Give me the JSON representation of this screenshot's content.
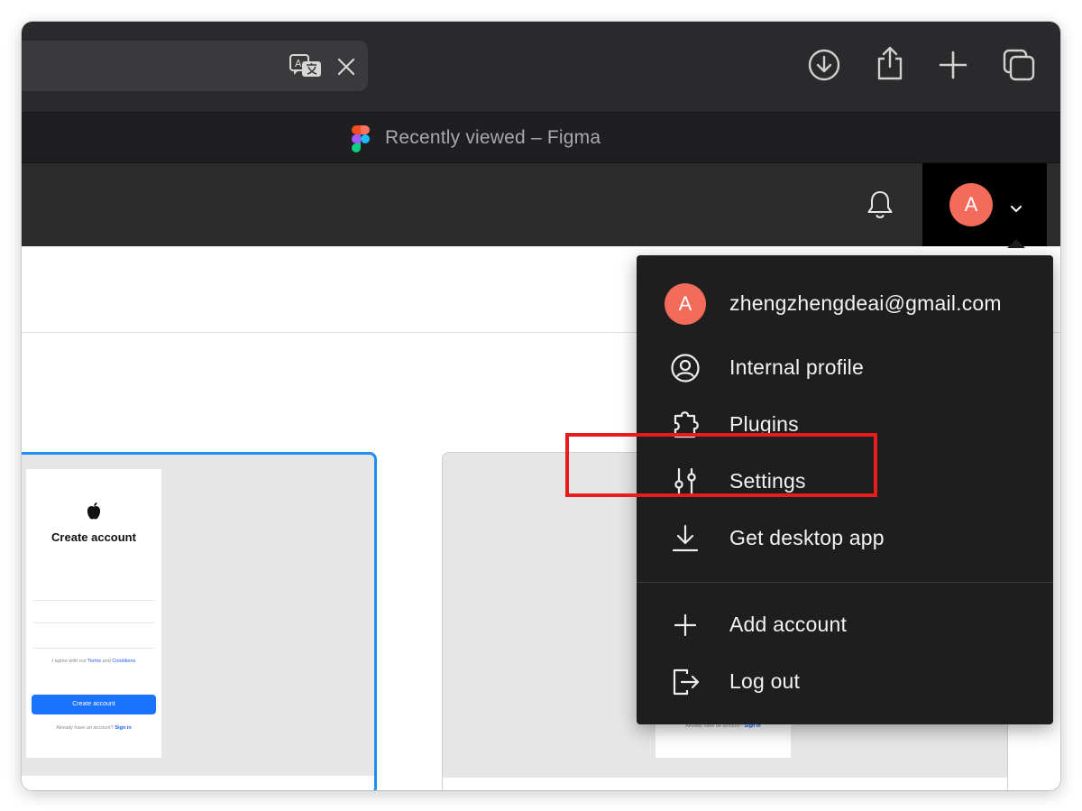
{
  "tab": {
    "title": "Recently viewed – Figma"
  },
  "account": {
    "avatar_initial": "A",
    "email": "zhengzhengdeai@gmail.com"
  },
  "menu": {
    "items": [
      {
        "label": "Internal profile",
        "icon": "user-circle-icon"
      },
      {
        "label": "Plugins",
        "icon": "puzzle-piece-icon"
      },
      {
        "label": "Settings",
        "icon": "sliders-icon",
        "highlighted": true
      },
      {
        "label": "Get desktop app",
        "icon": "download-icon"
      },
      {
        "label": "Add account",
        "icon": "plus-icon"
      },
      {
        "label": "Log out",
        "icon": "logout-icon"
      }
    ]
  },
  "file_card_1": {
    "screen_title": "Create account",
    "agree_prefix": "I agree with our",
    "terms": "Terms",
    "and": "and",
    "conditions": "Conditions",
    "button_label": "Create account",
    "signin_prefix": "Already have an account?",
    "signin_link": "Sign in"
  },
  "file_card_2": {
    "signin_prefix": "Already have an account?",
    "signin_link": "Sign in"
  },
  "colors": {
    "avatar": "#f26b5b",
    "menu_background": "#1e1e1e",
    "selected_card_border": "#1e8ef0",
    "highlight_box": "#e81c1c",
    "primary_button": "#1a73ff"
  }
}
